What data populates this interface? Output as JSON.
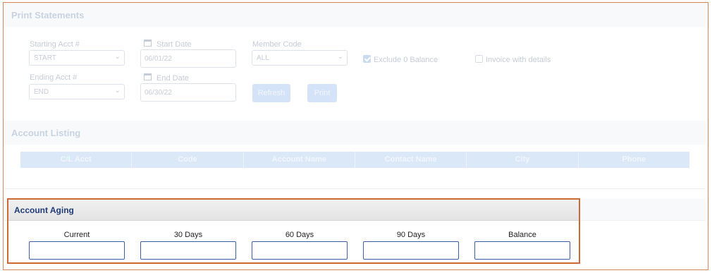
{
  "print_statements": {
    "title": "Print Statements",
    "starting_acct": {
      "label": "Starting Acct #",
      "value": "START"
    },
    "ending_acct": {
      "label": "Ending Acct #",
      "value": "END"
    },
    "start_date": {
      "label": "Start Date",
      "value": "06/01/22"
    },
    "end_date": {
      "label": "End Date",
      "value": "06/30/22"
    },
    "member_code": {
      "label": "Member Code",
      "value": "ALL"
    },
    "exclude_zero": {
      "label": "Exclude 0 Balance",
      "checked": true
    },
    "invoice_details": {
      "label": "Invoice with details",
      "checked": false
    },
    "refresh_label": "Refresh",
    "print_label": "Print"
  },
  "account_listing": {
    "title": "Account Listing",
    "columns": [
      "C/L Acct",
      "Code",
      "Account Name",
      "Contact Name",
      "City",
      "Phone"
    ]
  },
  "account_aging": {
    "title": "Account Aging",
    "columns": [
      {
        "label": "Current",
        "value": ""
      },
      {
        "label": "30 Days",
        "value": ""
      },
      {
        "label": "60 Days",
        "value": ""
      },
      {
        "label": "90 Days",
        "value": ""
      },
      {
        "label": "Balance",
        "value": ""
      }
    ]
  },
  "colors": {
    "highlight_border": "#cc6a34",
    "aging_title": "#1f3b78",
    "input_border": "#3a5da8"
  }
}
